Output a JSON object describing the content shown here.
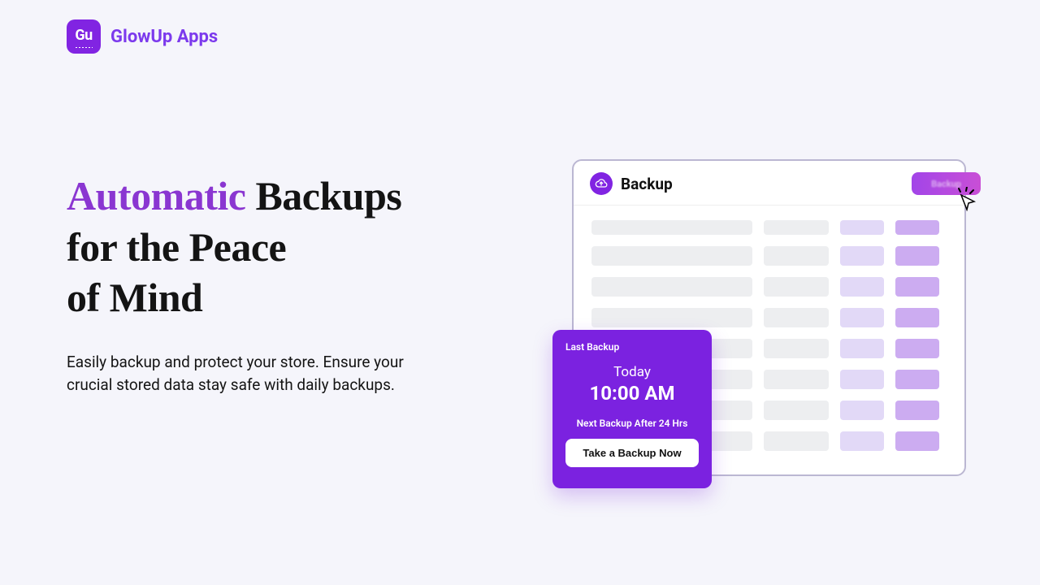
{
  "brand": {
    "name": "GlowUp Apps",
    "abbrev": "Gu"
  },
  "hero": {
    "headline_accent": "Automatic",
    "headline_rest": " Backups\nfor the Peace\nof Mind",
    "subtext": "Easily backup and protect your store. Ensure your crucial stored data stay safe with daily backups."
  },
  "panel": {
    "title": "Backup",
    "pill_label": "Backup"
  },
  "card": {
    "label": "Last Backup",
    "date": "Today",
    "time": "10:00 AM",
    "next": "Next Backup After 24 Hrs",
    "button": "Take a Backup Now"
  }
}
